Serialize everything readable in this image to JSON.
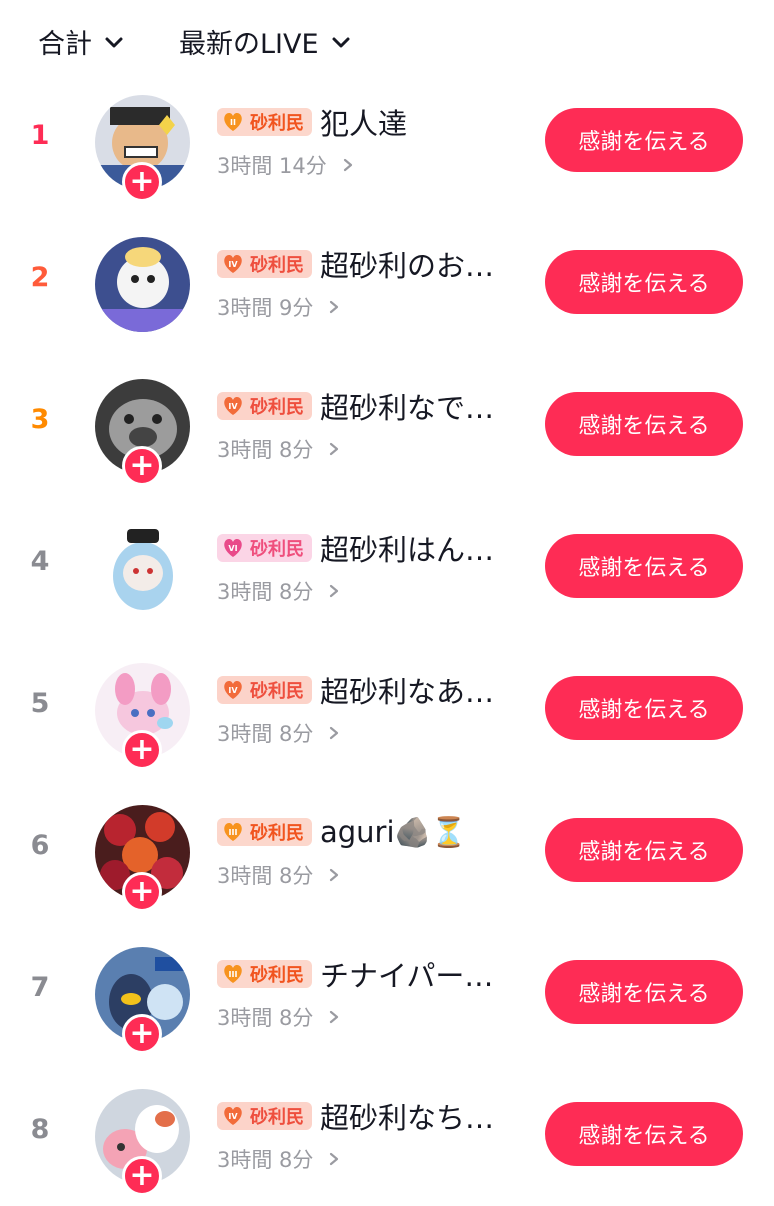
{
  "header": {
    "total_label": "合計",
    "live_label": "最新のLIVE"
  },
  "accent_color": "#fe2c55",
  "rows": [
    {
      "rank": "1",
      "badge": "砂利民",
      "name": "犯人達",
      "duration": "3時間 14分",
      "button": "感謝を伝える",
      "follow": "+"
    },
    {
      "rank": "2",
      "badge": "砂利民",
      "name": "超砂利のお…",
      "duration": "3時間 9分",
      "button": "感謝を伝える"
    },
    {
      "rank": "3",
      "badge": "砂利民",
      "name": "超砂利なで…",
      "duration": "3時間 8分",
      "button": "感謝を伝える",
      "follow": "+"
    },
    {
      "rank": "4",
      "badge": "砂利民",
      "name": "超砂利はん…",
      "duration": "3時間 8分",
      "button": "感謝を伝える"
    },
    {
      "rank": "5",
      "badge": "砂利民",
      "name": "超砂利なあ…",
      "duration": "3時間 8分",
      "button": "感謝を伝える",
      "follow": "+"
    },
    {
      "rank": "6",
      "badge": "砂利民",
      "name": "aguri🪨⏳",
      "duration": "3時間 8分",
      "button": "感謝を伝える",
      "follow": "+"
    },
    {
      "rank": "7",
      "badge": "砂利民",
      "name": "チナイパー…",
      "duration": "3時間 8分",
      "button": "感謝を伝える",
      "follow": "+"
    },
    {
      "rank": "8",
      "badge": "砂利民",
      "name": "超砂利なち…",
      "duration": "3時間 8分",
      "button": "感謝を伝える",
      "follow": "+"
    }
  ]
}
